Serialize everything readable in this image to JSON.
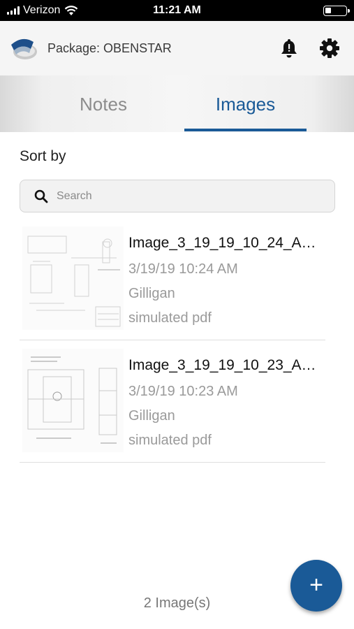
{
  "status_bar": {
    "carrier": "Verizon",
    "time": "11:21 AM"
  },
  "header": {
    "title": "Package: OBENSTAR",
    "icons": [
      "app-logo",
      "bell-icon",
      "gear-icon"
    ]
  },
  "tabs": [
    {
      "label": "Notes",
      "active": false
    },
    {
      "label": "Images",
      "active": true
    }
  ],
  "sort_label": "Sort by",
  "search": {
    "placeholder": "Search",
    "value": ""
  },
  "images": [
    {
      "name": "Image_3_19_19_10_24_A…",
      "date": "3/19/19 10:24 AM",
      "author": "Gilligan",
      "type": "simulated pdf"
    },
    {
      "name": "Image_3_19_19_10_23_A…",
      "date": "3/19/19 10:23 AM",
      "author": "Gilligan",
      "type": "simulated pdf"
    }
  ],
  "footer": {
    "count_text": "2 Image(s)"
  },
  "fab": {
    "label": "+"
  },
  "colors": {
    "accent": "#1a5a97",
    "inactive_tab": "#8c8c8c",
    "secondary_text": "#9a9a9a"
  }
}
